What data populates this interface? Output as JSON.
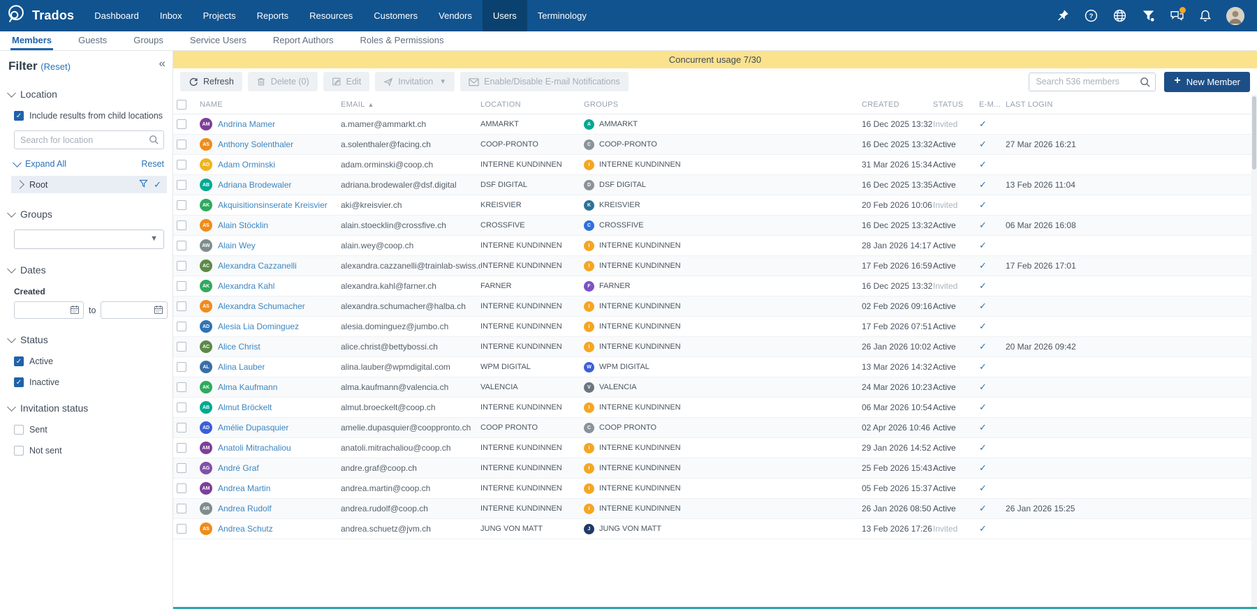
{
  "nav": {
    "brand": "Trados",
    "items": [
      {
        "label": "Dashboard",
        "active": false
      },
      {
        "label": "Inbox",
        "active": false
      },
      {
        "label": "Projects",
        "active": false
      },
      {
        "label": "Reports",
        "active": false
      },
      {
        "label": "Resources",
        "active": false
      },
      {
        "label": "Customers",
        "active": false
      },
      {
        "label": "Vendors",
        "active": false
      },
      {
        "label": "Users",
        "active": true
      },
      {
        "label": "Terminology",
        "active": false
      }
    ],
    "right_icons": [
      "pin-icon",
      "help-icon",
      "language-icon",
      "filter-icon",
      "messages-icon",
      "notifications-icon",
      "user-avatar"
    ],
    "messages_badge": true
  },
  "tabs": {
    "active": "Members",
    "items": [
      "Members",
      "Guests",
      "Groups",
      "Service Users",
      "Report Authors",
      "Roles & Permissions"
    ]
  },
  "banner": {
    "text": "Concurrent usage 7/30",
    "background": "#fbe28d"
  },
  "toolbar": {
    "refresh_label": "Refresh",
    "delete_label": "Delete (0)",
    "edit_label": "Edit",
    "invitation_label": "Invitation",
    "email_notifications_label": "Enable/Disable E-mail Notifications",
    "search_placeholder": "Search 536 members",
    "new_member_label": "New Member"
  },
  "filter": {
    "title": "Filter",
    "reset_label": "(Reset)",
    "location": {
      "label": "Location",
      "include_children_label": "Include results from child locations",
      "include_children_checked": true,
      "search_placeholder": "Search for location",
      "expand_all_label": "Expand All",
      "reset_label": "Reset",
      "root_label": "Root"
    },
    "groups": {
      "label": "Groups",
      "selected_value": ""
    },
    "dates": {
      "label": "Dates",
      "created_label": "Created",
      "from_value": "",
      "to_label": "to",
      "to_value": ""
    },
    "status": {
      "label": "Status",
      "options": [
        {
          "label": "Active",
          "checked": true
        },
        {
          "label": "Inactive",
          "checked": true
        }
      ]
    },
    "invitation_status": {
      "label": "Invitation status",
      "options": [
        {
          "label": "Sent",
          "checked": false
        },
        {
          "label": "Not sent",
          "checked": false
        }
      ]
    }
  },
  "table": {
    "columns": [
      "NAME",
      "EMAIL",
      "LOCATION",
      "GROUPS",
      "CREATED",
      "STATUS",
      "E-M...",
      "LAST LOGIN"
    ],
    "sort": {
      "column": "EMAIL",
      "direction": "asc"
    },
    "rows": [
      {
        "initials": "AM",
        "avatar_color": "#7d3f98",
        "name": "Andrina Mamer",
        "email": "a.mamer@ammarkt.ch",
        "location": "AMMARKT",
        "group": "AMMARKT",
        "group_color": "#00a992",
        "created": "16 Dec 2025 13:32",
        "status": "Invited",
        "email_notifications": true,
        "last_login": ""
      },
      {
        "initials": "AS",
        "avatar_color": "#ef8c1a",
        "name": "Anthony Solenthaler",
        "email": "a.solenthaler@facing.ch",
        "location": "COOP-PRONTO",
        "group": "COOP-PRONTO",
        "group_color": "#8a9399",
        "created": "16 Dec 2025 13:32",
        "status": "Active",
        "email_notifications": true,
        "last_login": "27 Mar 2026 16:21"
      },
      {
        "initials": "AO",
        "avatar_color": "#f0b31c",
        "name": "Adam Orminski",
        "email": "adam.orminski@coop.ch",
        "location": "INTERNE KUNDINNEN",
        "group": "INTERNE KUNDINNEN",
        "group_color": "#f5a623",
        "created": "31 Mar 2026 15:34",
        "status": "Active",
        "email_notifications": true,
        "last_login": ""
      },
      {
        "initials": "AB",
        "avatar_color": "#00a992",
        "name": "Adriana Brodewaler",
        "email": "adriana.brodewaler@dsf.digital",
        "location": "DSF DIGITAL",
        "group": "DSF DIGITAL",
        "group_color": "#8a9399",
        "created": "16 Dec 2025 13:35",
        "status": "Active",
        "email_notifications": true,
        "last_login": "13 Feb 2026 11:04"
      },
      {
        "initials": "AK",
        "avatar_color": "#2eaa5e",
        "name": "Akquisitionsinserate Kreisvier",
        "email": "aki@kreisvier.ch",
        "location": "KREISVIER",
        "group": "KREISVIER",
        "group_color": "#2e7096",
        "created": "20 Feb 2026 10:06",
        "status": "Invited",
        "email_notifications": true,
        "last_login": ""
      },
      {
        "initials": "AS",
        "avatar_color": "#ef8c1a",
        "name": "Alain Stöcklin",
        "email": "alain.stoecklin@crossfive.ch",
        "location": "CROSSFIVE",
        "group": "CROSSFIVE",
        "group_color": "#2f6fe4",
        "created": "16 Dec 2025 13:32",
        "status": "Active",
        "email_notifications": true,
        "last_login": "06 Mar 2026 16:08"
      },
      {
        "initials": "AW",
        "avatar_color": "#7f8c8d",
        "name": "Alain Wey",
        "email": "alain.wey@coop.ch",
        "location": "INTERNE KUNDINNEN",
        "group": "INTERNE KUNDINNEN",
        "group_color": "#f5a623",
        "created": "28 Jan 2026 14:17",
        "status": "Active",
        "email_notifications": true,
        "last_login": ""
      },
      {
        "initials": "AC",
        "avatar_color": "#5c8a46",
        "name": "Alexandra Cazzanelli",
        "email": "alexandra.cazzanelli@trainlab-swiss.ch",
        "location": "INTERNE KUNDINNEN",
        "group": "INTERNE KUNDINNEN",
        "group_color": "#f5a623",
        "created": "17 Feb 2026 16:59",
        "status": "Active",
        "email_notifications": true,
        "last_login": "17 Feb 2026 17:01"
      },
      {
        "initials": "AK",
        "avatar_color": "#2eaa5e",
        "name": "Alexandra Kahl",
        "email": "alexandra.kahl@farner.ch",
        "location": "FARNER",
        "group": "FARNER",
        "group_color": "#7b52c7",
        "created": "16 Dec 2025 13:32",
        "status": "Invited",
        "email_notifications": true,
        "last_login": ""
      },
      {
        "initials": "AS",
        "avatar_color": "#ef8c1a",
        "name": "Alexandra Schumacher",
        "email": "alexandra.schumacher@halba.ch",
        "location": "INTERNE KUNDINNEN",
        "group": "INTERNE KUNDINNEN",
        "group_color": "#f5a623",
        "created": "02 Feb 2026 09:16",
        "status": "Active",
        "email_notifications": true,
        "last_login": ""
      },
      {
        "initials": "AD",
        "avatar_color": "#2e73b8",
        "name": "Alesia Lia Dominguez",
        "email": "alesia.dominguez@jumbo.ch",
        "location": "INTERNE KUNDINNEN",
        "group": "INTERNE KUNDINNEN",
        "group_color": "#f5a623",
        "created": "17 Feb 2026 07:51",
        "status": "Active",
        "email_notifications": true,
        "last_login": ""
      },
      {
        "initials": "AC",
        "avatar_color": "#5c8a46",
        "name": "Alice Christ",
        "email": "alice.christ@bettybossi.ch",
        "location": "INTERNE KUNDINNEN",
        "group": "INTERNE KUNDINNEN",
        "group_color": "#f5a623",
        "created": "26 Jan 2026 10:02",
        "status": "Active",
        "email_notifications": true,
        "last_login": "20 Mar 2026 09:42"
      },
      {
        "initials": "AL",
        "avatar_color": "#3a6ea8",
        "name": "Alina Lauber",
        "email": "alina.lauber@wpmdigital.com",
        "location": "WPM DIGITAL",
        "group": "WPM DIGITAL",
        "group_color": "#3a5fd9",
        "created": "13 Mar 2026 14:32",
        "status": "Active",
        "email_notifications": true,
        "last_login": ""
      },
      {
        "initials": "AK",
        "avatar_color": "#2eaa5e",
        "name": "Alma Kaufmann",
        "email": "alma.kaufmann@valencia.ch",
        "location": "VALENCIA",
        "group": "VALENCIA",
        "group_color": "#6b7680",
        "created": "24 Mar 2026 10:23",
        "status": "Active",
        "email_notifications": true,
        "last_login": ""
      },
      {
        "initials": "AB",
        "avatar_color": "#00a992",
        "name": "Almut Bröckelt",
        "email": "almut.broeckelt@coop.ch",
        "location": "INTERNE KUNDINNEN",
        "group": "INTERNE KUNDINNEN",
        "group_color": "#f5a623",
        "created": "06 Mar 2026 10:54",
        "status": "Active",
        "email_notifications": true,
        "last_login": ""
      },
      {
        "initials": "AD",
        "avatar_color": "#3a5fd9",
        "name": "Amélie Dupasquier",
        "email": "amelie.dupasquier@cooppronto.ch",
        "location": "COOP PRONTO",
        "group": "COOP PRONTO",
        "group_color": "#8a9399",
        "created": "02 Apr 2026 10:46",
        "status": "Active",
        "email_notifications": true,
        "last_login": ""
      },
      {
        "initials": "AM",
        "avatar_color": "#7d3f98",
        "name": "Anatoli Mitrachaliou",
        "email": "anatoli.mitrachaliou@coop.ch",
        "location": "INTERNE KUNDINNEN",
        "group": "INTERNE KUNDINNEN",
        "group_color": "#f5a623",
        "created": "29 Jan 2026 14:52",
        "status": "Active",
        "email_notifications": true,
        "last_login": ""
      },
      {
        "initials": "AG",
        "avatar_color": "#8250a8",
        "name": "André Graf",
        "email": "andre.graf@coop.ch",
        "location": "INTERNE KUNDINNEN",
        "group": "INTERNE KUNDINNEN",
        "group_color": "#f5a623",
        "created": "25 Feb 2026 15:43",
        "status": "Active",
        "email_notifications": true,
        "last_login": ""
      },
      {
        "initials": "AM",
        "avatar_color": "#7d3f98",
        "name": "Andrea Martin",
        "email": "andrea.martin@coop.ch",
        "location": "INTERNE KUNDINNEN",
        "group": "INTERNE KUNDINNEN",
        "group_color": "#f5a623",
        "created": "05 Feb 2026 15:37",
        "status": "Active",
        "email_notifications": true,
        "last_login": ""
      },
      {
        "initials": "AR",
        "avatar_color": "#7f8c8d",
        "name": "Andrea Rudolf",
        "email": "andrea.rudolf@coop.ch",
        "location": "INTERNE KUNDINNEN",
        "group": "INTERNE KUNDINNEN",
        "group_color": "#f5a623",
        "created": "26 Jan 2026 08:50",
        "status": "Active",
        "email_notifications": true,
        "last_login": "26 Jan 2026 15:25"
      },
      {
        "initials": "AS",
        "avatar_color": "#ef8c1a",
        "name": "Andrea Schutz",
        "email": "andrea.schuetz@jvm.ch",
        "location": "JUNG VON MATT",
        "group": "JUNG VON MATT",
        "group_color": "#1f3a66",
        "created": "13 Feb 2026 17:26",
        "status": "Invited",
        "email_notifications": true,
        "last_login": ""
      }
    ]
  },
  "colors": {
    "topnav": "#10538f",
    "accent": "#1f63a9",
    "banner_bg": "#fbe28d",
    "new_member_button": "#1c4f87",
    "bottom_line": "#2ba6ab"
  }
}
